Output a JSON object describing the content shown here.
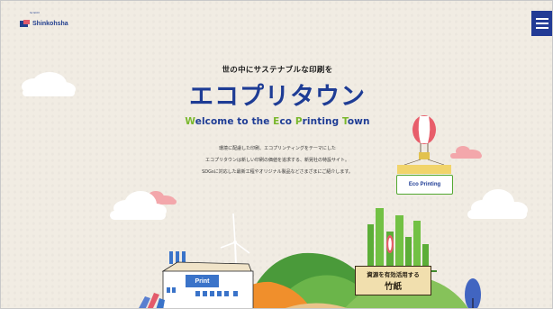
{
  "header": {
    "logo_text": "Shinkohsha",
    "logo_sub": "for ECO",
    "menu_icon": "hamburger-icon"
  },
  "hero": {
    "tagline": "世の中にサステナブルな印刷を",
    "title": "エコプリタウン",
    "welcome_parts": [
      "W",
      "elcome to the ",
      "E",
      "co ",
      "P",
      "rinting ",
      "T",
      "own"
    ],
    "description": [
      "環境に配慮した印刷、エコプリンティングをテーマにした",
      "エコプリタウンは新しい印刷の価値を追求する、新晃社の特設サイト。",
      "SDGsに対応した最新工程やオリジナル製品などさまざまにご紹介します。"
    ]
  },
  "illustration": {
    "balloon_sign": "Eco Printing",
    "factory_sign": "Print",
    "bamboo_sign_line1": "資源を有効活用する",
    "bamboo_sign_line2": "竹紙"
  },
  "colors": {
    "brand_blue": "#1e3c95",
    "accent_green": "#79b72c",
    "background": "#f1ece3"
  }
}
